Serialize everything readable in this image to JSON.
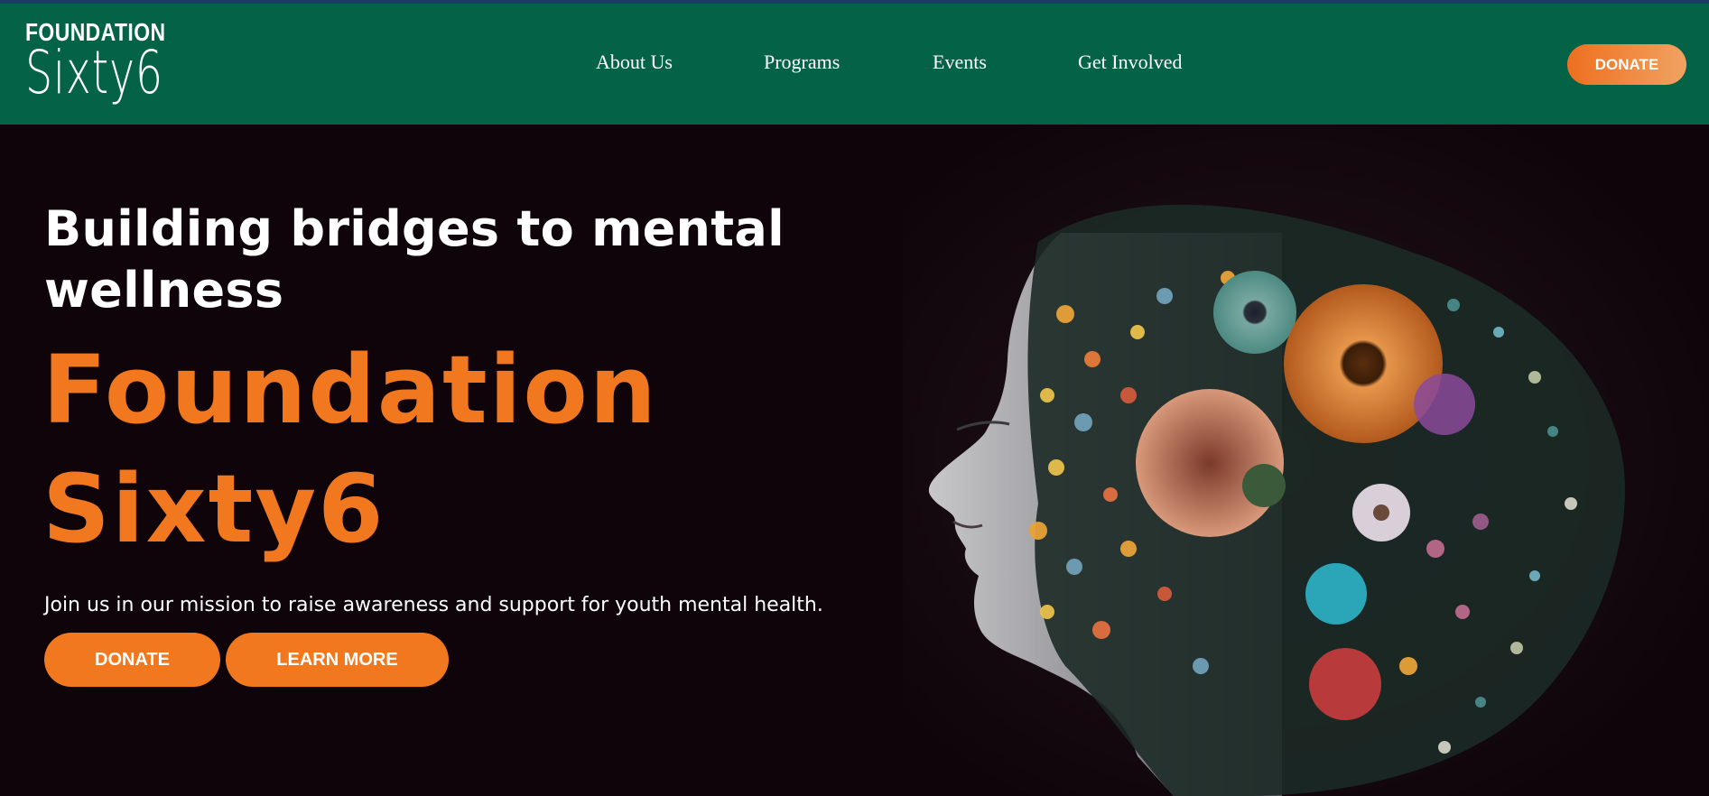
{
  "header": {
    "logo_top": "FOUNDATION",
    "logo_bottom": "Sixty6",
    "nav": [
      "About Us",
      "Programs",
      "Events",
      "Get Involved"
    ],
    "donate_label": "DONATE"
  },
  "hero": {
    "headline_line1": "Building bridges to mental",
    "headline_line2": "wellness",
    "brand_line1": "Foundation",
    "brand_line2": "Sixty6",
    "mission": "Join us in our mission to raise awareness and support for youth mental health.",
    "donate_label": "DONATE",
    "learn_more_label": "LEARN MORE",
    "image": "woman-profile-flowers-illustration"
  },
  "colors": {
    "header_bg": "#046246",
    "page_bg": "#0e0409",
    "accent": "#f2781f"
  }
}
